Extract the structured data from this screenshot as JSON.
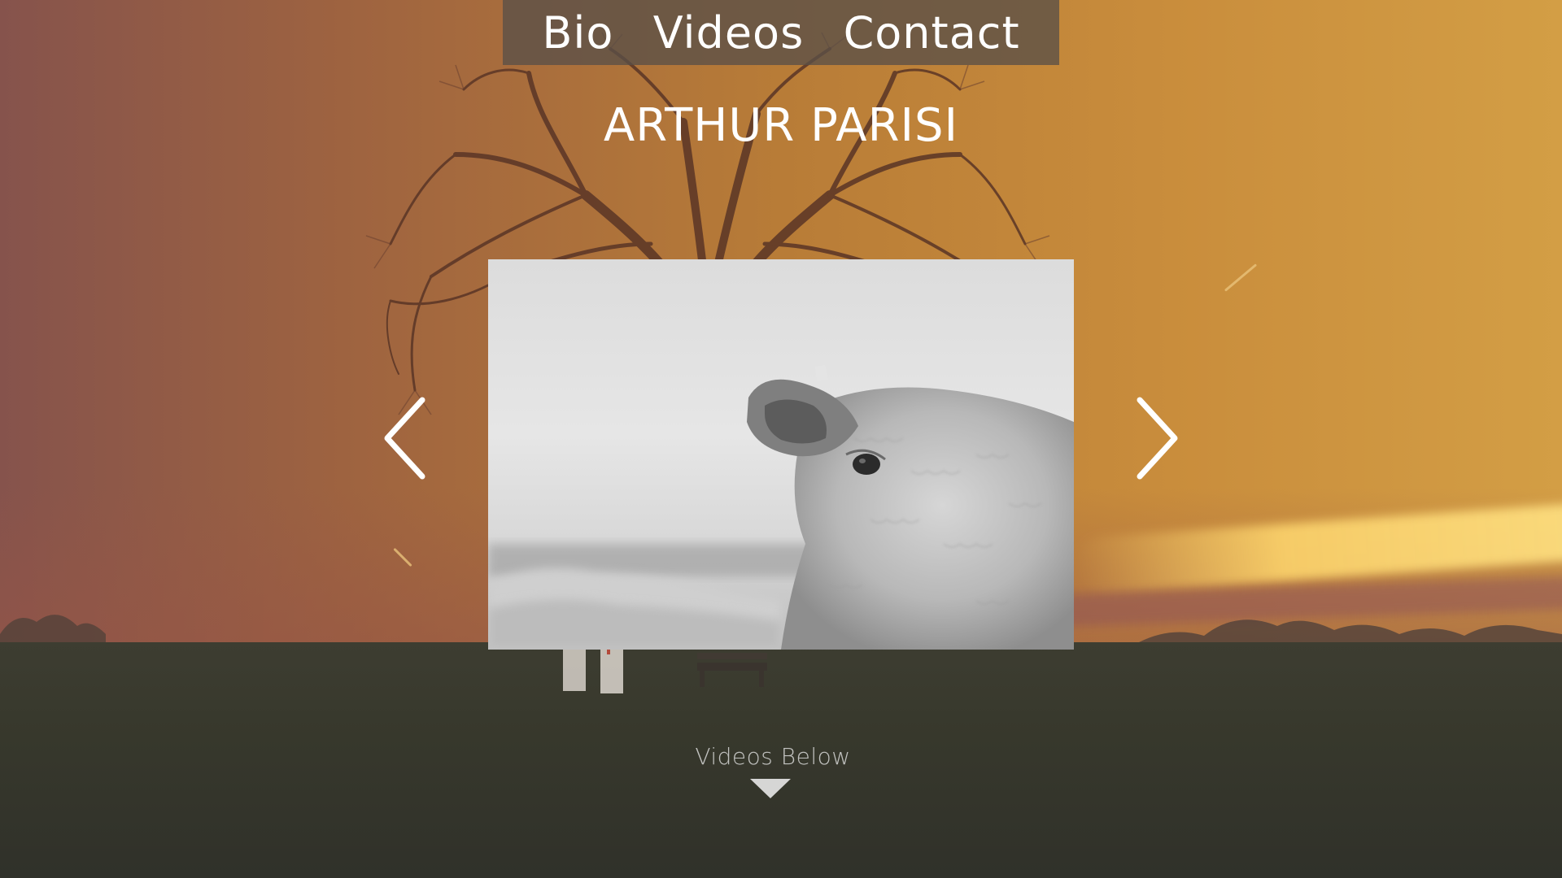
{
  "nav": {
    "items": [
      {
        "label": "Bio"
      },
      {
        "label": "Videos"
      },
      {
        "label": "Contact"
      }
    ]
  },
  "header": {
    "title": "ARTHUR PARISI"
  },
  "slider": {
    "image_subject": "sheep-photo",
    "prev_icon": "chevron-left-icon",
    "next_icon": "chevron-right-icon"
  },
  "scroll_hint": {
    "label": "Videos Below",
    "icon": "triangle-down-icon"
  },
  "colors": {
    "nav_bg": "#5a5048",
    "text": "#ffffff",
    "sky_left": "#86534c",
    "sky_right": "#d39e45",
    "field": "#37382c"
  }
}
